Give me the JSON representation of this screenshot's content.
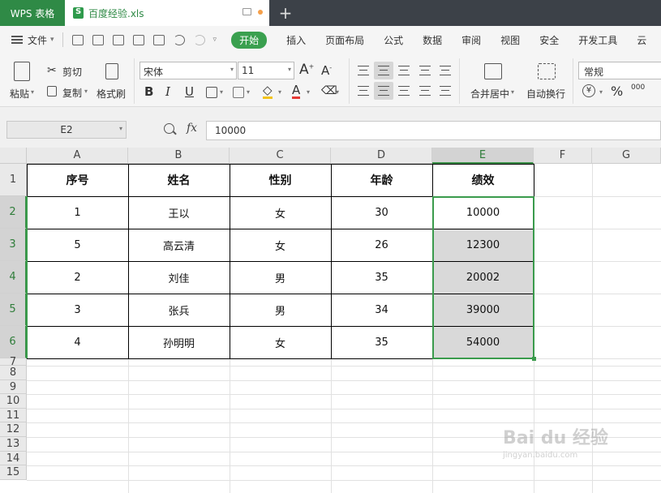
{
  "titlebar": {
    "app_name": "WPS 表格",
    "doc_name": "百度经验.xls",
    "new_tab": "+"
  },
  "menubar": {
    "file": "文件",
    "items": [
      "开始",
      "插入",
      "页面布局",
      "公式",
      "数据",
      "审阅",
      "视图",
      "安全",
      "开发工具",
      "云"
    ]
  },
  "ribbon": {
    "paste": "粘贴",
    "cut": "剪切",
    "copy": "复制",
    "format_painter": "格式刷",
    "font_name": "宋体",
    "font_size": "11",
    "merge_center": "合并居中",
    "wrap_text": "自动换行",
    "number_format": "常规",
    "percent": "%",
    "thousands": "000"
  },
  "formula_bar": {
    "name_box": "E2",
    "fx": "fx",
    "value": "10000"
  },
  "grid": {
    "columns": [
      "A",
      "B",
      "C",
      "D",
      "E",
      "F",
      "G"
    ],
    "rows": [
      "1",
      "2",
      "3",
      "4",
      "5",
      "6",
      "7",
      "8",
      "9",
      "10",
      "11",
      "12",
      "13",
      "14",
      "15"
    ],
    "headers": [
      "序号",
      "姓名",
      "性别",
      "年龄",
      "绩效"
    ],
    "data": [
      [
        "1",
        "王以",
        "女",
        "30",
        "10000"
      ],
      [
        "5",
        "高云清",
        "女",
        "26",
        "12300"
      ],
      [
        "2",
        "刘佳",
        "男",
        "35",
        "20002"
      ],
      [
        "3",
        "张兵",
        "男",
        "34",
        "39000"
      ],
      [
        "4",
        "孙明明",
        "女",
        "35",
        "54000"
      ]
    ],
    "selected_column": "E",
    "selected_rows": [
      "2",
      "3",
      "4",
      "5",
      "6"
    ]
  },
  "watermark": {
    "text": "Bai du 经验",
    "url": "jingyan.baidu.com"
  },
  "colors": {
    "accent_green": "#3aa04f",
    "title_dark": "#3c4148",
    "selection_gray": "#d9d9d9"
  }
}
